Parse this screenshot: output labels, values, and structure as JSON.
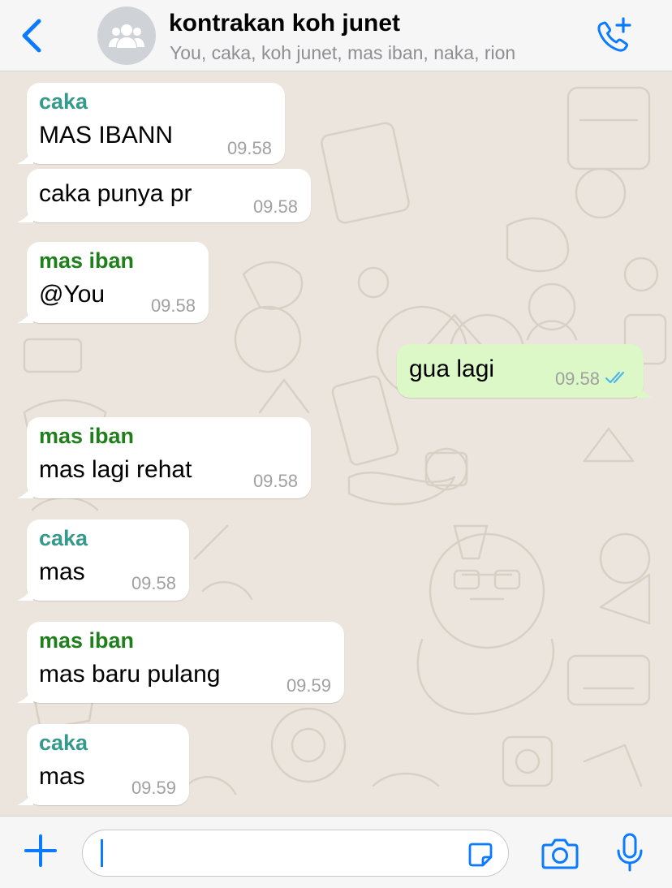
{
  "header": {
    "back_icon": "chevron-left-icon",
    "avatar_icon": "group-icon",
    "title": "kontrakan koh junet",
    "participants": "You, caka, koh junet, mas iban, naka, rion",
    "call_icon": "add-call-icon"
  },
  "colors": {
    "accent": "#0A7AFF",
    "chat_background": "#ECE5DD",
    "incoming_bubble": "#FFFFFF",
    "outgoing_bubble": "#DCF8C6",
    "sender_caka": "#35998B",
    "sender_mas_iban": "#1F7F1A",
    "read_ticks": "#4FB6EC"
  },
  "messages": [
    {
      "direction": "in",
      "sender": "caka",
      "text": "MAS IBANN",
      "time": "09.58"
    },
    {
      "direction": "in",
      "sender": "",
      "text": "caka punya pr",
      "time": "09.58"
    },
    {
      "direction": "in",
      "sender": "mas iban",
      "text": "@You",
      "time": "09.58"
    },
    {
      "direction": "out",
      "sender": "",
      "text": "gua lagi",
      "time": "09.58",
      "status": "read"
    },
    {
      "direction": "in",
      "sender": "mas iban",
      "text": "mas lagi rehat",
      "time": "09.58"
    },
    {
      "direction": "in",
      "sender": "caka",
      "text": "mas",
      "time": "09.58"
    },
    {
      "direction": "in",
      "sender": "mas iban",
      "text": "mas baru pulang",
      "time": "09.59"
    },
    {
      "direction": "in",
      "sender": "caka",
      "text": "mas",
      "time": "09.59"
    }
  ],
  "composer": {
    "attach_icon": "plus-icon",
    "input_value": "",
    "sticker_icon": "sticker-icon",
    "camera_icon": "camera-icon",
    "mic_icon": "microphone-icon"
  }
}
